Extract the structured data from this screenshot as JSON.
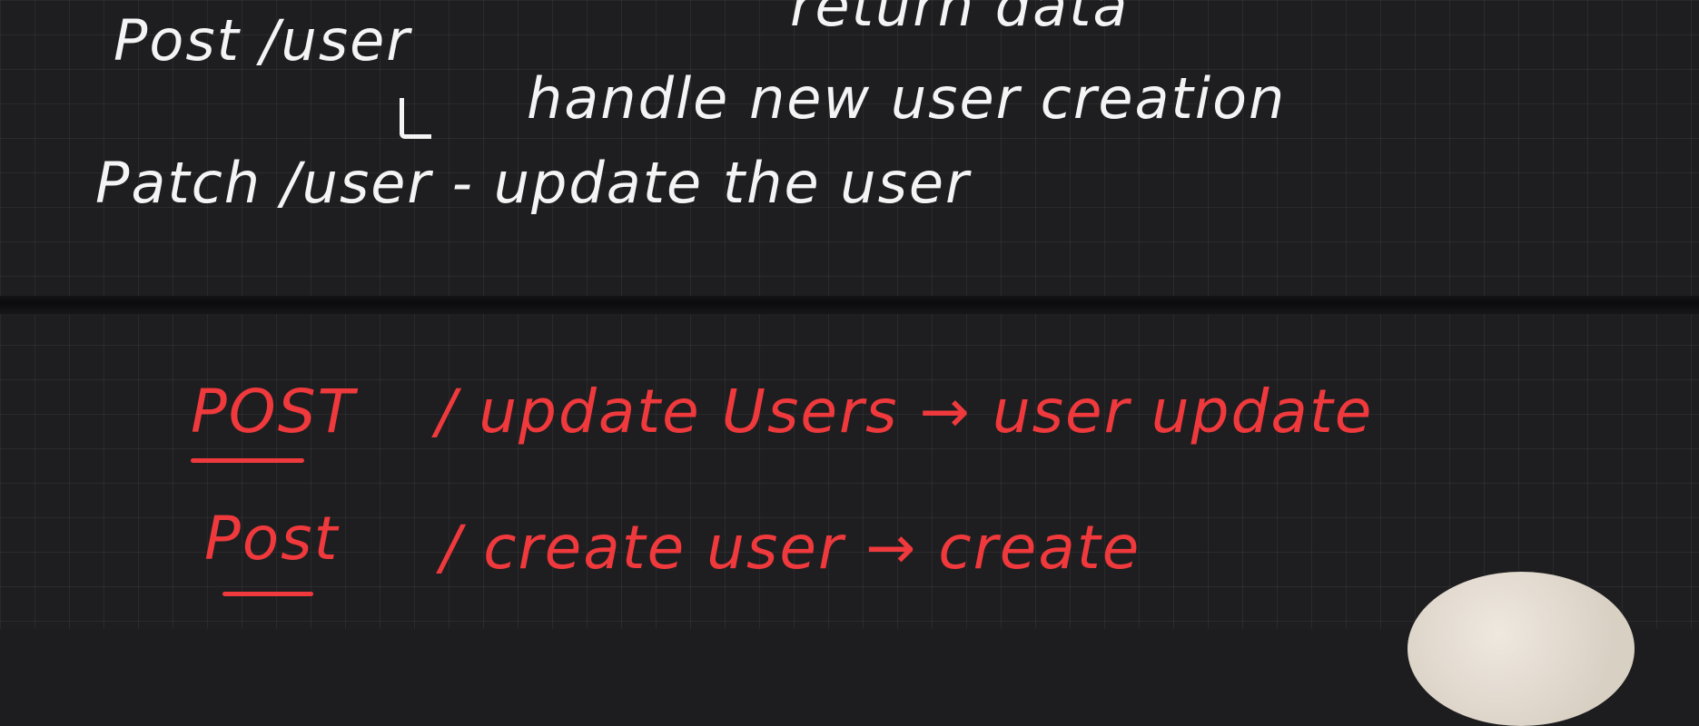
{
  "board": {
    "line0_partial": "return data",
    "line1": "Post /user",
    "line2": "handle new user creation",
    "line3": "Patch /user - update the user",
    "red1_method": "POST",
    "red1_rest": "/ update Users → user update",
    "red2_method": "Post",
    "red2_rest": "/ create user → create"
  },
  "colors": {
    "background": "#1e1e20",
    "ink_white": "#f4f4f4",
    "ink_red": "#f0393c"
  }
}
